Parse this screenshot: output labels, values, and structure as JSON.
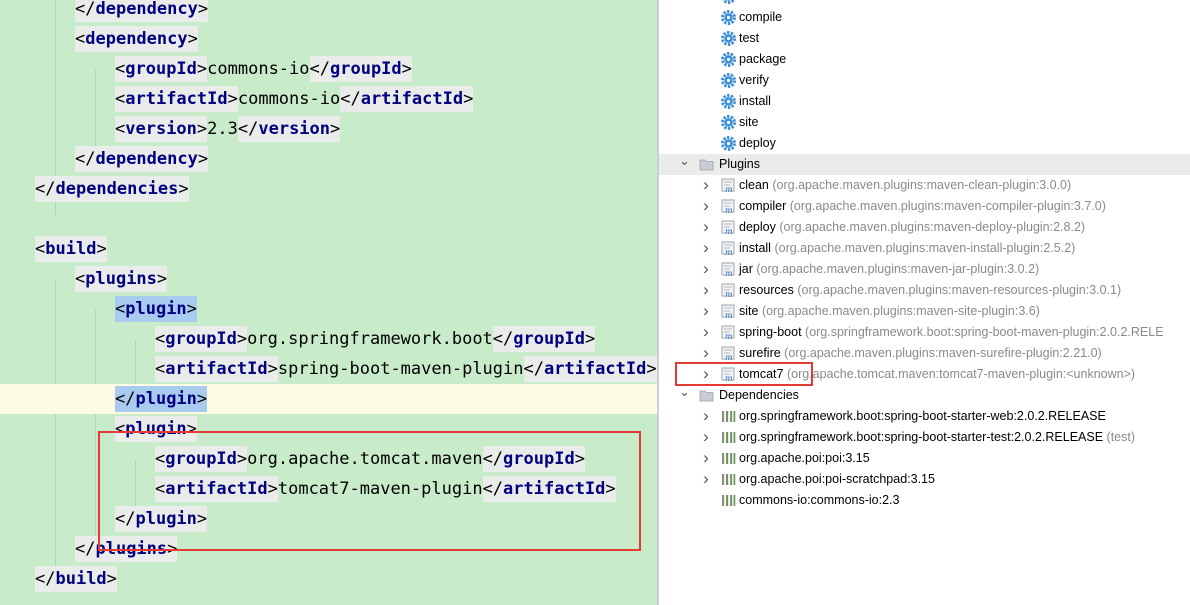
{
  "editor": {
    "lines": [
      {
        "kind": "close",
        "tag": "dependency"
      },
      {
        "kind": "open",
        "tag": "dependency"
      },
      {
        "kind": "elem",
        "tag": "groupId",
        "text": "commons-io"
      },
      {
        "kind": "elem",
        "tag": "artifactId",
        "text": "commons-io"
      },
      {
        "kind": "elem",
        "tag": "version",
        "text": "2.3"
      },
      {
        "kind": "close",
        "tag": "dependency"
      },
      {
        "kind": "close",
        "tag": "dependencies"
      },
      {
        "kind": "open",
        "tag": "build"
      },
      {
        "kind": "open",
        "tag": "plugins"
      },
      {
        "kind": "open",
        "tag": "plugin"
      },
      {
        "kind": "elem",
        "tag": "groupId",
        "text": "org.springframework.boot"
      },
      {
        "kind": "elem",
        "tag": "artifactId",
        "text": "spring-boot-maven-plugin"
      },
      {
        "kind": "close",
        "tag": "plugin"
      },
      {
        "kind": "open",
        "tag": "plugin"
      },
      {
        "kind": "elem",
        "tag": "groupId",
        "text": "org.apache.tomcat.maven"
      },
      {
        "kind": "elem",
        "tag": "artifactId",
        "text": "tomcat7-maven-plugin"
      },
      {
        "kind": "close",
        "tag": "plugin"
      },
      {
        "kind": "close",
        "tag": "plugins"
      },
      {
        "kind": "close",
        "tag": "build"
      }
    ]
  },
  "maven_tree": {
    "lifecycle": [
      "compile",
      "test",
      "package",
      "verify",
      "install",
      "site",
      "deploy"
    ],
    "plugins_label": "Plugins",
    "plugins": [
      {
        "name": "clean",
        "coord": "(org.apache.maven.plugins:maven-clean-plugin:3.0.0)"
      },
      {
        "name": "compiler",
        "coord": "(org.apache.maven.plugins:maven-compiler-plugin:3.7.0)"
      },
      {
        "name": "deploy",
        "coord": "(org.apache.maven.plugins:maven-deploy-plugin:2.8.2)"
      },
      {
        "name": "install",
        "coord": "(org.apache.maven.plugins:maven-install-plugin:2.5.2)"
      },
      {
        "name": "jar",
        "coord": "(org.apache.maven.plugins:maven-jar-plugin:3.0.2)"
      },
      {
        "name": "resources",
        "coord": "(org.apache.maven.plugins:maven-resources-plugin:3.0.1)"
      },
      {
        "name": "site",
        "coord": "(org.apache.maven.plugins:maven-site-plugin:3.6)"
      },
      {
        "name": "spring-boot",
        "coord": "(org.springframework.boot:spring-boot-maven-plugin:2.0.2.RELE"
      },
      {
        "name": "surefire",
        "coord": "(org.apache.maven.plugins:maven-surefire-plugin:2.21.0)"
      },
      {
        "name": "tomcat7",
        "coord": "(org.apache.tomcat.maven:tomcat7-maven-plugin:<unknown>)"
      }
    ],
    "dependencies_label": "Dependencies",
    "dependencies": [
      {
        "name": "org.springframework.boot:spring-boot-starter-web:2.0.2.RELEASE",
        "scope": ""
      },
      {
        "name": "org.springframework.boot:spring-boot-starter-test:2.0.2.RELEASE",
        "scope": "(test)"
      },
      {
        "name": "org.apache.poi:poi:3.15",
        "scope": ""
      },
      {
        "name": "org.apache.poi:poi-scratchpad:3.15",
        "scope": ""
      },
      {
        "name": "commons-io:commons-io:2.3",
        "scope": ""
      }
    ]
  },
  "colors": {
    "editor_bg": "#c8ebc9",
    "tag_name": "#000080",
    "highlight_box": "#e53935",
    "matched_tag": "#aacbf0",
    "gear_icon": "#3c8fd6"
  },
  "icons": {
    "lifecycle": "gear-icon",
    "plugin": "maven-plugin-icon",
    "dependency": "library-icon",
    "bulb": "lightbulb-icon"
  }
}
